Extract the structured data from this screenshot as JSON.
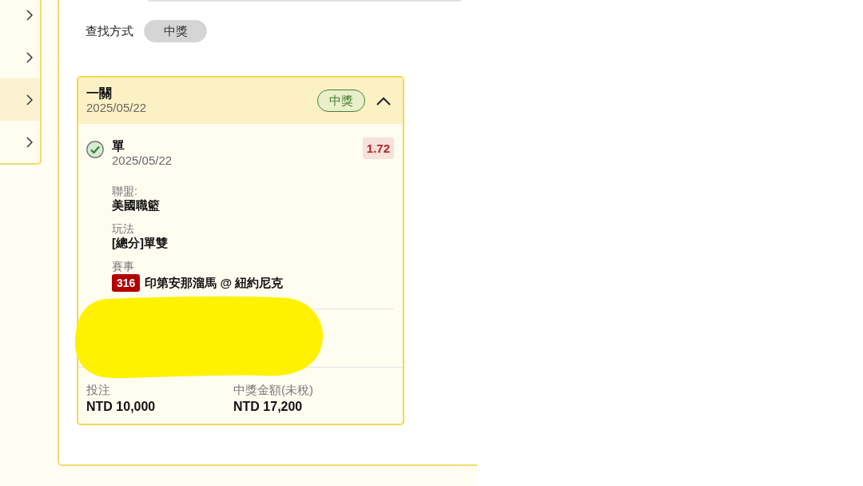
{
  "sidebar": {
    "items": [
      {
        "selected": false
      },
      {
        "selected": false
      },
      {
        "selected": true
      },
      {
        "selected": false
      }
    ]
  },
  "search_method": {
    "label": "查找方式",
    "options": [
      {
        "label": "中獎",
        "selected": true
      }
    ]
  },
  "ticket": {
    "title": "一關",
    "date": "2025/05/22",
    "status": "中獎",
    "expanded": true,
    "legs": [
      {
        "won": true,
        "selection": "單",
        "date": "2025/05/22",
        "odds": "1.72",
        "fields": [
          {
            "label": "聯盟:",
            "value": "美國職籃"
          },
          {
            "label": "玩法",
            "value": "[總分]單雙"
          },
          {
            "label": "賽事",
            "number": "316",
            "value": "印第安那溜馬 @ 紐約尼克"
          }
        ]
      }
    ],
    "redacted": true,
    "totals": [
      {
        "label": "投注",
        "value": "NTD 10,000"
      },
      {
        "label": "中獎金額(未稅)",
        "value": "NTD 17,200"
      }
    ]
  }
}
